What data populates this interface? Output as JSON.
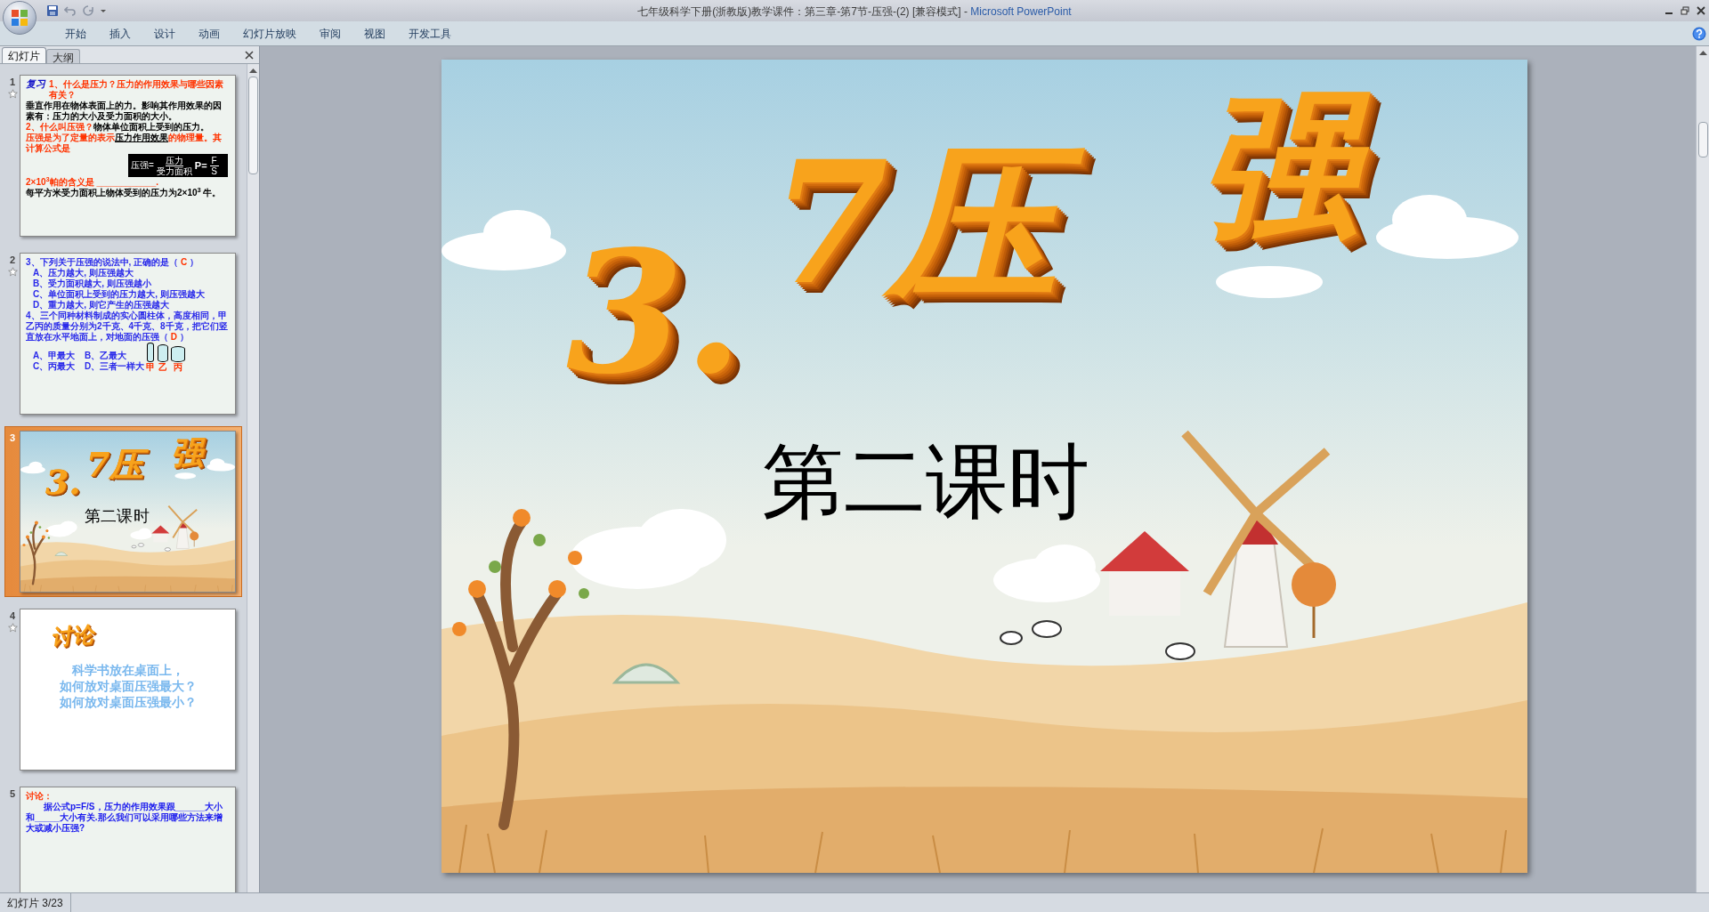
{
  "window": {
    "document_title": "七年级科学下册(浙教版)教学课件：第三章-第7节-压强-(2) [兼容模式]",
    "separator": "-",
    "app_name": "Microsoft PowerPoint"
  },
  "ribbon_tabs": [
    "开始",
    "插入",
    "设计",
    "动画",
    "幻灯片放映",
    "审阅",
    "视图",
    "开发工具"
  ],
  "pane_tabs": [
    {
      "label": "幻灯片",
      "selected": true
    },
    {
      "label": "大纲",
      "selected": false
    }
  ],
  "thumbnails": [
    {
      "number": "1",
      "animated": true,
      "selected": false,
      "kind": "quiz",
      "blocks": [
        {
          "kind": "tag",
          "text": "复习"
        },
        {
          "kind": "para",
          "runs": [
            {
              "text": "1、什么是压力？压力的作用效果与哪些因素有关？",
              "color": "#ff3300"
            }
          ]
        },
        {
          "kind": "para",
          "runs": [
            {
              "text": "垂直作用在物体表面上的力。影响其作用效果的因素有：压力的大小及受力面积的大小。",
              "color": "#000000"
            }
          ]
        },
        {
          "kind": "para",
          "runs": [
            {
              "text": "2、什么叫压强？",
              "color": "#ff3300"
            },
            {
              "text": "物体单位面积上受到的压力。",
              "color": "#000000"
            }
          ]
        },
        {
          "kind": "para",
          "runs": [
            {
              "text": "压强是为了定量的表示",
              "color": "#ff3300"
            },
            {
              "text": "压力作用效果",
              "color": "#000000",
              "underline": true
            },
            {
              "text": "的物理量。其计算公式是",
              "color": "#ff3300"
            }
          ]
        },
        {
          "kind": "formula",
          "label": "压强=",
          "numerator": "压力",
          "denominator": "受力面积",
          "symbol": "P=",
          "top": "F",
          "bottom": "S"
        },
        {
          "kind": "para",
          "runs": [
            {
              "text": "2×10$^{3}$帕的含义是 ____________.",
              "color": "#ff3300"
            }
          ]
        },
        {
          "kind": "para",
          "runs": [
            {
              "text": "每平方米受力面积上物体受到的压力为2×10$^{3}$ 牛。",
              "color": "#000000"
            }
          ]
        }
      ]
    },
    {
      "number": "2",
      "animated": true,
      "selected": false,
      "kind": "quiz",
      "blocks": [
        {
          "kind": "para",
          "color": "#2b2bea",
          "runs": [
            {
              "text": "3、下列关于压强的说法中, 正确的是（ "
            },
            {
              "text": "C",
              "color": "#ff3300"
            },
            {
              "text": " ）"
            }
          ]
        },
        {
          "kind": "list",
          "color": "#2b2bea",
          "items": [
            "A、压力越大, 则压强越大",
            "B、受力面积越大, 则压强越小",
            "C、单位面积上受到的压力越大, 则压强越大",
            "D、重力越大, 则它产生的压强越大"
          ]
        },
        {
          "kind": "para",
          "color": "#2b2bea",
          "runs": [
            {
              "text": "4、三个同种材料制成的实心圆柱体，高度相同，甲乙丙的质量分别为2千克、4千克、8千克，把它们竖直放在水平地面上，对地面的压强（ "
            },
            {
              "text": "D",
              "color": "#ff3300"
            },
            {
              "text": " ）"
            }
          ]
        },
        {
          "kind": "choices_figure",
          "color": "#2b2bea",
          "items": [
            "A、甲最大",
            "B、乙最大",
            "C、丙最大",
            "D、三者一样大"
          ],
          "labels": [
            "甲",
            "乙",
            "丙"
          ]
        }
      ]
    },
    {
      "number": "3",
      "animated": false,
      "selected": true,
      "kind": "title",
      "title_parts": [
        "3.",
        "7压",
        "强"
      ],
      "subtitle": "第二课时"
    },
    {
      "number": "4",
      "animated": true,
      "selected": false,
      "kind": "discussion",
      "blocks": [
        {
          "kind": "heading",
          "text": "讨论"
        },
        {
          "kind": "center",
          "color": "#7ab8ee",
          "lines": [
            "科学书放在桌面上，",
            "如何放对桌面压强最大？",
            "如何放对桌面压强最小？"
          ]
        }
      ]
    },
    {
      "number": "5",
      "animated": false,
      "selected": false,
      "kind": "quiz",
      "blocks": [
        {
          "kind": "para",
          "runs": [
            {
              "text": "讨论：",
              "color": "#ff3300"
            }
          ]
        },
        {
          "kind": "para",
          "runs": [
            {
              "text": "　　据公式p=F/S，压力的作用效果跟______大小和_____大小有关.那么我们可以采用哪些方法来增大或减小压强?",
              "color": "#1a1aee"
            }
          ]
        }
      ]
    }
  ],
  "slide": {
    "title_parts": [
      "3.",
      "7压",
      "强"
    ],
    "subtitle": "第二课时"
  },
  "status_bar": {
    "slide_counter": "幻灯片 3/23"
  }
}
